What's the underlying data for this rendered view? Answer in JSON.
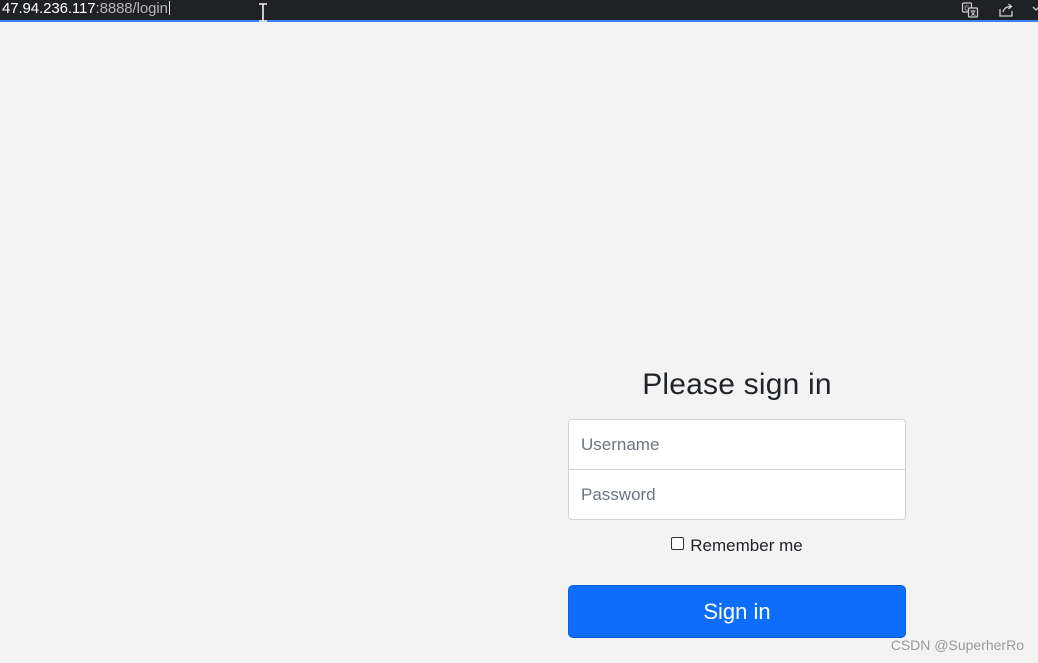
{
  "browser": {
    "url_host": "47.94.236.117",
    "url_rest": ":8888/login",
    "icons": {
      "translate": "translate-icon",
      "share": "share-icon",
      "more": "chevron-down-icon",
      "cursor": "text-cursor-icon"
    },
    "accent_color": "#3b82f6"
  },
  "login": {
    "heading": "Please sign in",
    "username_placeholder": "Username",
    "password_placeholder": "Password",
    "remember_label": "Remember me",
    "remember_checked": false,
    "submit_label": "Sign in",
    "button_color": "#0d6efd"
  },
  "watermark": "CSDN @SuperherRo"
}
